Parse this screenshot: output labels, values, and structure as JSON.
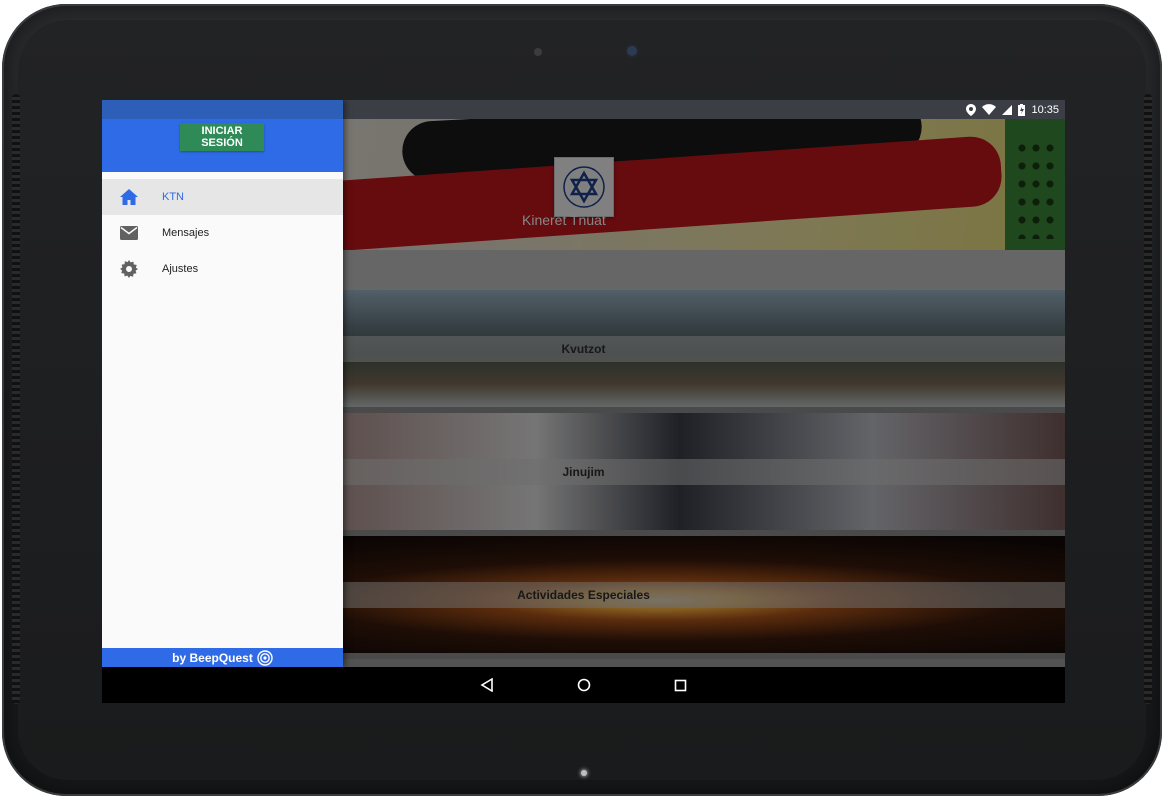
{
  "status_bar": {
    "time": "10:35"
  },
  "app": {
    "title": "Kineret Tnuat",
    "cards": [
      {
        "label": "Kvutzot"
      },
      {
        "label": "Jinujim"
      },
      {
        "label": "Actividades Especiales"
      }
    ]
  },
  "drawer": {
    "login_label": "INICIAR SESIÓN",
    "menu": [
      {
        "label": "KTN",
        "icon": "home-icon",
        "active": true
      },
      {
        "label": "Mensajes",
        "icon": "envelope-icon",
        "active": false
      },
      {
        "label": "Ajustes",
        "icon": "gear-icon",
        "active": false
      }
    ],
    "footer": "by BeepQuest"
  },
  "colors": {
    "drawer_header": "#2f6be6",
    "login_button": "#2e8b57",
    "active_menu_text": "#2f6be6"
  }
}
